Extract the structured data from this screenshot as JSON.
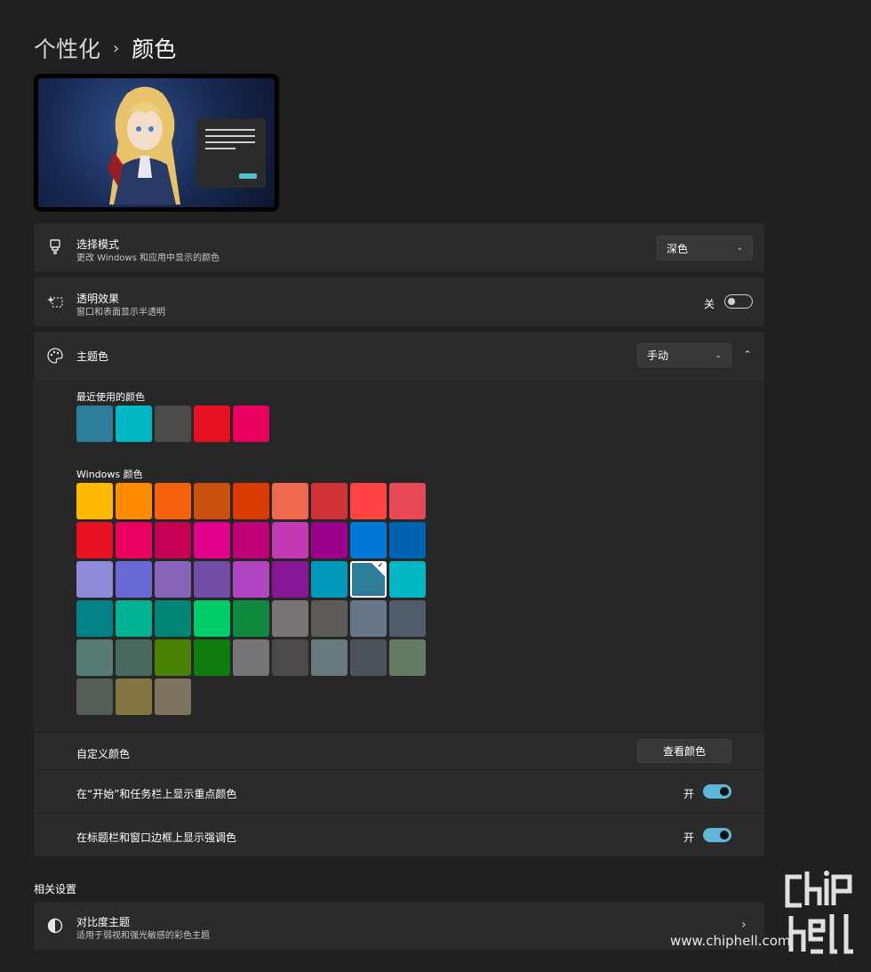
{
  "breadcrumb": {
    "parent": "个性化",
    "separator": "›",
    "current": "颜色"
  },
  "mode": {
    "title": "选择模式",
    "subtitle": "更改 Windows 和应用中显示的颜色",
    "value": "深色"
  },
  "transparency": {
    "title": "透明效果",
    "subtitle": "窗口和表面显示半透明",
    "state_label": "关",
    "on": false
  },
  "accent": {
    "title": "主题色",
    "value": "手动",
    "recent_label": "最近使用的颜色",
    "recent_colors": [
      "#2d7d9a",
      "#00b7c3",
      "#4c4a48",
      "#e81123",
      "#ea005e"
    ],
    "windows_label": "Windows 颜色",
    "windows_colors": [
      [
        "#ffb900",
        "#ff8c00",
        "#f7630c",
        "#ca5010",
        "#da3b01",
        "#ef6950",
        "#d13438",
        "#ff4343",
        "#e74856"
      ],
      [
        "#e81123",
        "#ea005e",
        "#c30052",
        "#e3008c",
        "#bf0077",
        "#c239b3",
        "#9a0089",
        "#0078d7",
        "#0063b1"
      ],
      [
        "#8e8cd8",
        "#6b69d6",
        "#8764b8",
        "#744da9",
        "#b146c2",
        "#881798",
        "#0099bc",
        "#2d7d9a",
        "#00b7c3"
      ],
      [
        "#038387",
        "#00b294",
        "#018574",
        "#00cc6a",
        "#10893e",
        "#7a7574",
        "#5d5a58",
        "#68768a",
        "#515c6b"
      ],
      [
        "#567c73",
        "#486860",
        "#498205",
        "#107c10",
        "#767676",
        "#4c4a48",
        "#69797e",
        "#4a5459",
        "#647c64"
      ],
      [
        "#525e54",
        "#847545",
        "#7e735f"
      ]
    ],
    "selected_color": "#2d7d9a"
  },
  "custom_color": {
    "label": "自定义颜色",
    "button": "查看颜色"
  },
  "show_on_start": {
    "label": "在“开始”和任务栏上显示重点颜色",
    "state_label": "开",
    "on": true
  },
  "show_on_title": {
    "label": "在标题栏和窗口边框上显示强调色",
    "state_label": "开",
    "on": true
  },
  "related": {
    "heading": "相关设置",
    "contrast": {
      "title": "对比度主题",
      "subtitle": "适用于弱视和强光敏感的彩色主题"
    }
  },
  "watermark": {
    "site": "www.chiphell.com",
    "logo_text": "chip hell"
  }
}
